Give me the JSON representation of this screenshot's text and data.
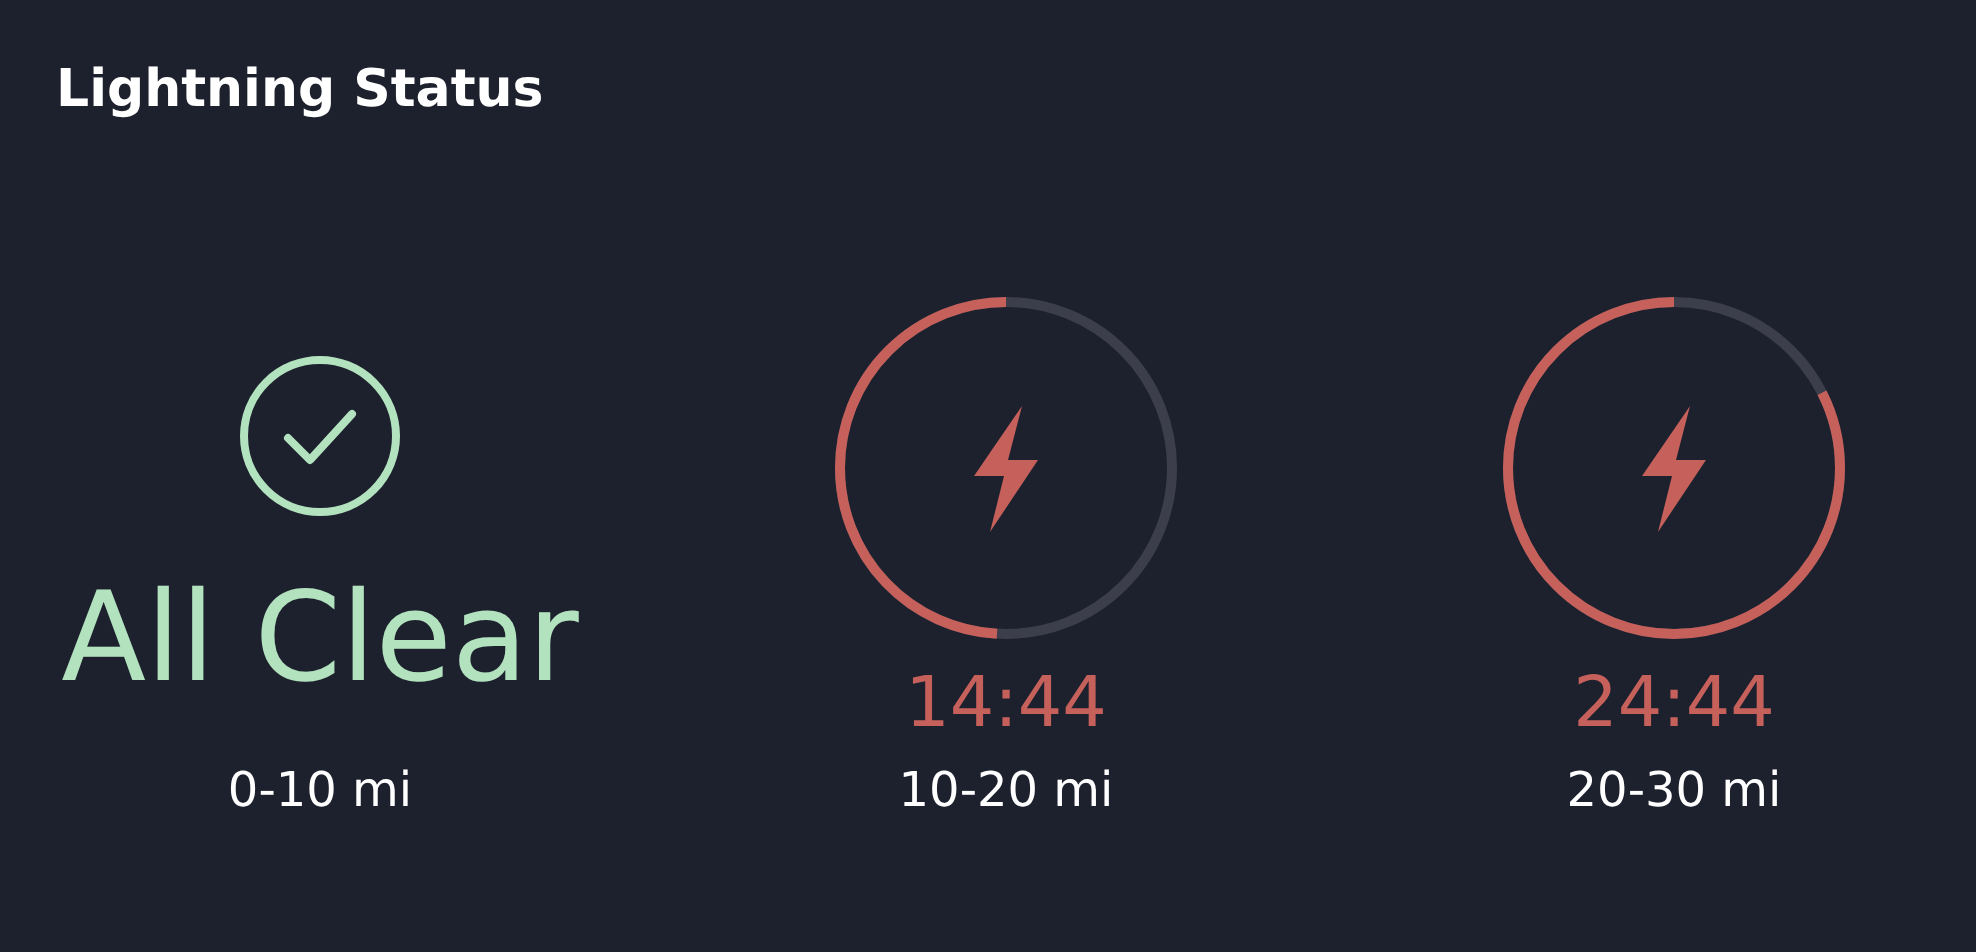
{
  "title": "Lightning Status",
  "zones": [
    {
      "kind": "clear",
      "status": "All Clear",
      "range": "0-10 mi"
    },
    {
      "kind": "timer",
      "time": "14:44",
      "range": "10-20 mi"
    },
    {
      "kind": "timer",
      "time": "24:44",
      "range": "20-30 mi"
    }
  ]
}
